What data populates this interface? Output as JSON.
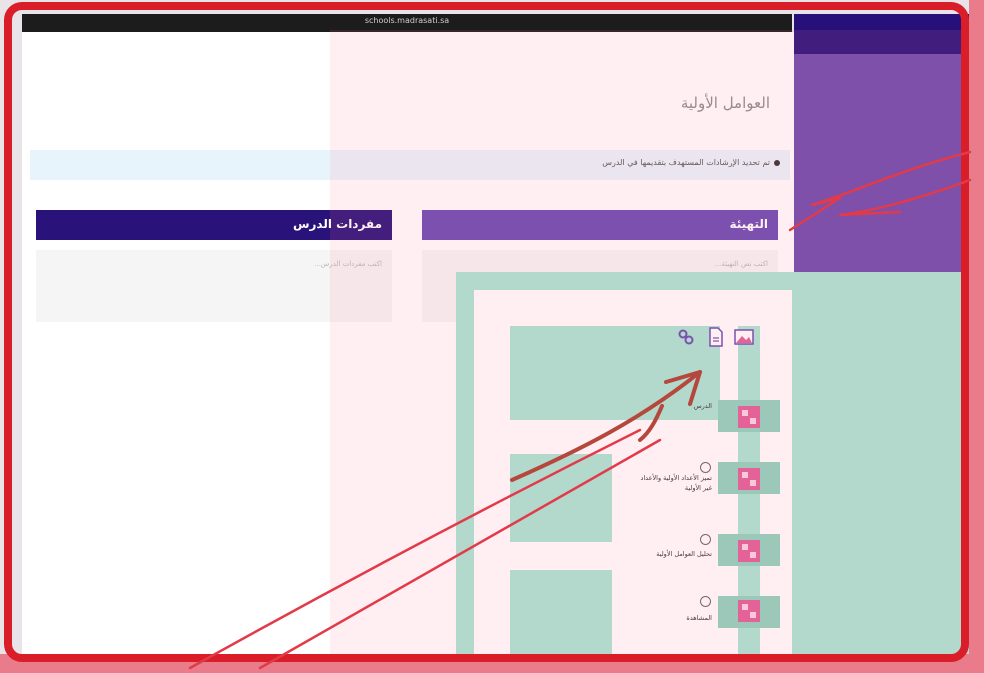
{
  "browser": {
    "url": "schools.madrasati.sa"
  },
  "page": {
    "title": "العوامل الأولية",
    "info": "تم تحديد الإرشادات المستهدف بتقديمها في الدرس"
  },
  "panels": {
    "preparation": {
      "title": "التهيئة",
      "placeholder": "اكتب نص التهيئة..."
    },
    "vocabulary": {
      "title": "مفردات الدرس",
      "placeholder": "اكتب مفردات الدرس..."
    }
  },
  "toolbar": {
    "icons": [
      "link-icon",
      "file-icon",
      "image-icon"
    ]
  },
  "options": [
    {
      "label": "الدرس"
    },
    {
      "label": "تميز الأعداد الأولية والأعداد غير الأولية"
    },
    {
      "label": "تحليل العوامل الأولية"
    },
    {
      "label": "المشاهدة"
    }
  ],
  "colors": {
    "frame_red": "#d91e2a",
    "purple": "#6a4bb3",
    "dark_purple": "#29127a",
    "mint": "#a9e5d4",
    "pink_icon": "#e0609a"
  }
}
